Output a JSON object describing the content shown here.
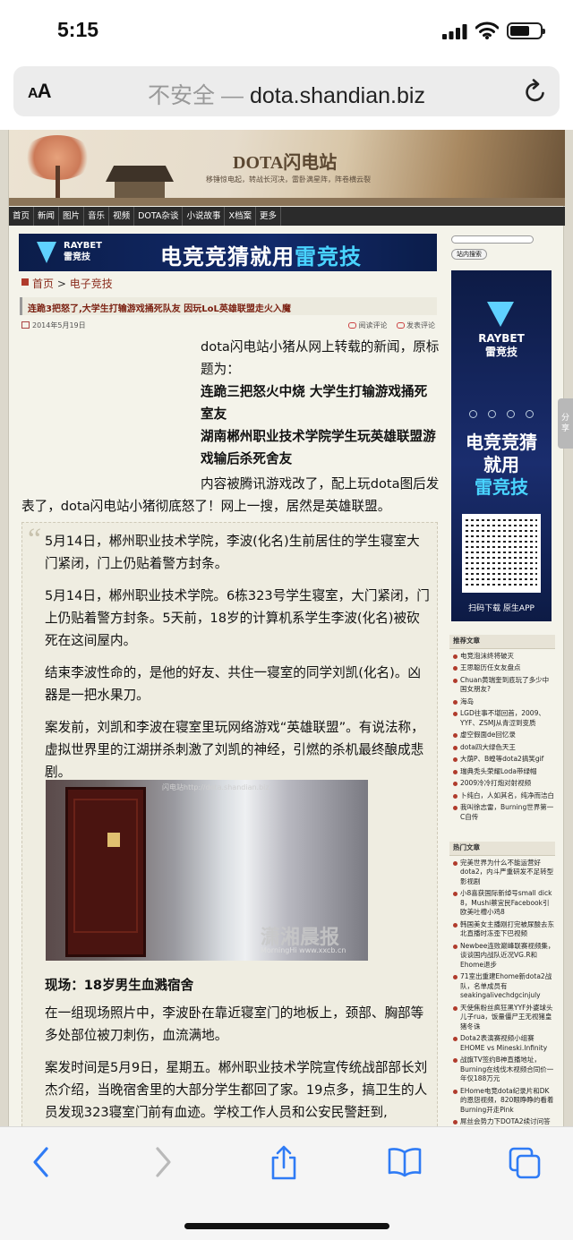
{
  "status": {
    "time": "5:15",
    "battery_level": 0.65
  },
  "urlbar": {
    "aa": "AA",
    "insecure": "不安全",
    "sep": "—",
    "domain": "dota.shandian.biz"
  },
  "site": {
    "title": "DOTA闪电站",
    "subtitle": "移锤惊电起，转战长河决，雷卧满星阵，阵卷横云裂",
    "nav": [
      "首页",
      "新闻",
      "图片",
      "音乐",
      "视频",
      "DOTA杂谈",
      "小说故事",
      "X档案",
      "更多"
    ]
  },
  "ad_top": {
    "brand1": "RAYBET",
    "brand2": "雷竞技",
    "slogan_a": "电竞竞猜就用",
    "slogan_b": "雷竞技"
  },
  "breadcrumb": {
    "home": "首页",
    "sep": ">",
    "category": "电子竞技"
  },
  "headline": "连跪3把怒了,大学生打输游戏捅死队友 因玩LoL英雄联盟走火入魔",
  "meta": {
    "date": "2014年5月19日",
    "read": "阅读评论",
    "post": "发表评论"
  },
  "article": {
    "intro": "dota闪电站小猪从网上转载的新闻，原标题为：",
    "title1": "连跪三把怒火中烧 大学生打输游戏捅死室友",
    "title2": "湖南郴州职业技术学院学生玩英雄联盟游戏输后杀死舍友",
    "para": "内容被腾讯游戏改了，配上玩dota图后发表了，dota闪电站小猪彻底怒了！网上一搜，居然是英雄联盟。"
  },
  "quote": {
    "p1": "5月14日，郴州职业技术学院，李波(化名)生前居住的学生寝室大门紧闭，门上仍贴着警方封条。",
    "p2": "5月14日，郴州职业技术学院。6栋323号学生寝室，大门紧闭，门上仍贴着警方封条。5天前，18岁的计算机系学生李波(化名)被砍死在这间屋内。",
    "p3": "结束李波性命的，是他的好友、共住一寝室的同学刘凯(化名)。凶器是一把水果刀。",
    "p4": "案发前，刘凯和李波在寝室里玩网络游戏“英雄联盟”。有说法称，虚拟世界里的江湖拼杀刺激了刘凯的神经，引燃的杀机最终酿成悲剧。",
    "photo_wm": "闪电站http://dota.shandian.biz",
    "photo_wm2": "潇湘晨报",
    "photo_wm3": "MorningHi www.xxcb.cn",
    "h3": "现场：18岁男生血溅宿舍",
    "p5": "在一组现场照片中，李波卧在靠近寝室门的地板上，颈部、胸部等多处部位被刀刺伤，血流满地。",
    "p6": "案发时间是5月9日，星期五。郴州职业技术学院宣传统战部部长刘杰介绍，当晚宿舍里的大部分学生都回了家。19点多，搞卫生的人员发现323寝室门前有血迹。学校工作人员和公安民警赶到,"
  },
  "sidebar": {
    "search_btn": "站内搜索",
    "ad": {
      "brand1": "RAYBET",
      "brand2": "雷竞技",
      "line1": "电竞竞猜",
      "line2": "就用",
      "line3": "雷竞技",
      "download": "扫码下载 原生APP"
    },
    "rec_title": "推荐文章",
    "rec": [
      "电竞泡沫终将破灭",
      "王思聪历任女友盘点",
      "Chuan黄瑞奎到底玩了多少中国女朋友?",
      "海岛",
      "LGD往事不堪回首，2009、YYF、ZSMJ从青涩到变质",
      "虚空假面de回忆录",
      "dota四大绿色天王",
      "大荫P、B蝗等dota2搞笑gif",
      "瑞典秃头荣耀Loda带绿帽",
      "2009冷冷打炮对射视频",
      "卜纯白，人如其名，纯净而洁白",
      "我叫徐志雷，Burning世界第一C自传"
    ],
    "hot_title": "热门文章",
    "hot": [
      "完美世界为什么不能运营好dota2，内斗严重研发不足转型影视剧",
      "小8喜获国际新绰号small dick 8，Mushi蔡宜民Facebook引欧美吐槽小鸡8",
      "韩国美女主播刚打完被尿酸去东北直播时冻歪下巴视频",
      "Newbee连败巅峰联赛视频集，谈谈国内战队近况VG.R和Ehome退步",
      "71室出重建Ehome新dota2战队，名单成员有seakingalivechdgcinjuly",
      "天使焦粉丝疯狂黑YYF外婆球头儿子rua，饭量僵尸王无视猪皇猪冬诛",
      "Dota2表演赛视频小组赛EHOME vs Mineski.Infinity",
      "战旗TV签约B神直播地址，Burning在线伐木视频合同价一年仅188万元",
      "EHome电竞dota纪录片和DK的恩怨视频，820眼睁睁的看着Burning开走Pink",
      "屌丝会势力下DOTA2续讨问答"
    ]
  },
  "share": "分享"
}
